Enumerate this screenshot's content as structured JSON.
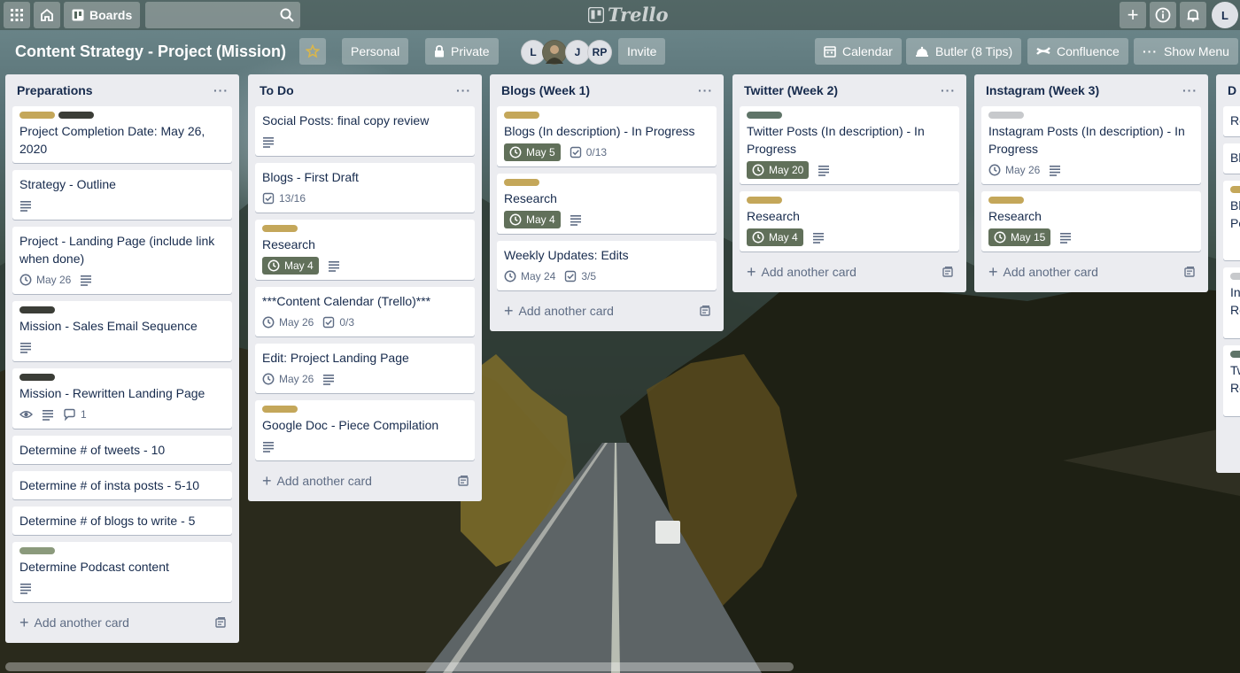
{
  "header": {
    "boards_label": "Boards",
    "logo_text": "Trello",
    "user_initial": "L"
  },
  "board": {
    "title": "Content Strategy - Project (Mission)",
    "personal_label": "Personal",
    "private_label": "Private",
    "members": [
      "L",
      "J",
      "RP"
    ],
    "invite_label": "Invite",
    "calendar_label": "Calendar",
    "butler_label": "Butler (8 Tips)",
    "confluence_label": "Confluence",
    "show_menu_label": "Show Menu"
  },
  "add_card_label": "Add another card",
  "colors": {
    "label_gold": "#c4a75a",
    "label_dark": "#3b3d37",
    "label_slate": "#5f7468",
    "label_sage": "#8b9a7c",
    "label_grey": "#c7c9cc",
    "due_badge": "#61705a"
  },
  "lists": [
    {
      "title": "Preparations",
      "cards": [
        {
          "labels": [
            "gold",
            "dark"
          ],
          "title": "Project Completion Date: May 26, 2020"
        },
        {
          "title": "Strategy - Outline",
          "badges": {
            "description": true
          }
        },
        {
          "title": "Project - Landing Page (include link when done)",
          "badges": {
            "due": "May 26",
            "description": true
          }
        },
        {
          "labels": [
            "dark"
          ],
          "title": "Mission - Sales Email Sequence",
          "badges": {
            "description": true
          }
        },
        {
          "labels": [
            "dark"
          ],
          "title": "Mission - Rewritten Landing Page",
          "badges": {
            "watching": true,
            "description": true,
            "comments": "1"
          }
        },
        {
          "title": "Determine # of tweets - 10"
        },
        {
          "title": "Determine # of insta posts - 5-10"
        },
        {
          "title": "Determine # of blogs to write - 5"
        },
        {
          "labels": [
            "sage"
          ],
          "title": "Determine Podcast content",
          "badges": {
            "description": true
          }
        }
      ]
    },
    {
      "title": "To Do",
      "cards": [
        {
          "title": "Social Posts: final copy review",
          "badges": {
            "description": true
          }
        },
        {
          "title": "Blogs - First Draft",
          "badges": {
            "checklist": "13/16"
          }
        },
        {
          "labels": [
            "gold"
          ],
          "title": "Research",
          "badges": {
            "due_highlight": "May 4",
            "description": true
          }
        },
        {
          "title": "***Content Calendar (Trello)***",
          "badges": {
            "due": "May 26",
            "checklist": "0/3"
          }
        },
        {
          "title": "Edit: Project Landing Page",
          "badges": {
            "due": "May 26",
            "description": true
          }
        },
        {
          "labels": [
            "gold"
          ],
          "title": "Google Doc - Piece Compilation",
          "badges": {
            "description": true
          }
        }
      ]
    },
    {
      "title": "Blogs (Week 1)",
      "cards": [
        {
          "labels": [
            "gold"
          ],
          "title": "Blogs (In description) - In Progress",
          "badges": {
            "due_highlight": "May 5",
            "checklist": "0/13"
          }
        },
        {
          "labels": [
            "gold"
          ],
          "title": "Research",
          "badges": {
            "due_highlight": "May 4",
            "description": true
          }
        },
        {
          "title": "Weekly Updates: Edits",
          "badges": {
            "due": "May 24",
            "checklist": "3/5"
          }
        }
      ]
    },
    {
      "title": "Twitter (Week 2)",
      "cards": [
        {
          "labels": [
            "slate"
          ],
          "title": "Twitter Posts (In description) - In Progress",
          "badges": {
            "due_highlight": "May 20",
            "description": true
          }
        },
        {
          "labels": [
            "gold"
          ],
          "title": "Research",
          "badges": {
            "due_highlight": "May 4",
            "description": true
          }
        }
      ]
    },
    {
      "title": "Instagram (Week 3)",
      "cards": [
        {
          "labels": [
            "grey"
          ],
          "title": "Instagram Posts (In description) - In Progress",
          "badges": {
            "due": "May 26",
            "description": true
          }
        },
        {
          "labels": [
            "gold"
          ],
          "title": "Research",
          "badges": {
            "due_highlight": "May 15",
            "description": true
          }
        }
      ]
    }
  ],
  "partial_list": {
    "title": "D",
    "fragments": [
      "Re",
      "Bl",
      "Bl",
      "Po",
      "In",
      "Re",
      "Tw",
      "Re"
    ]
  }
}
